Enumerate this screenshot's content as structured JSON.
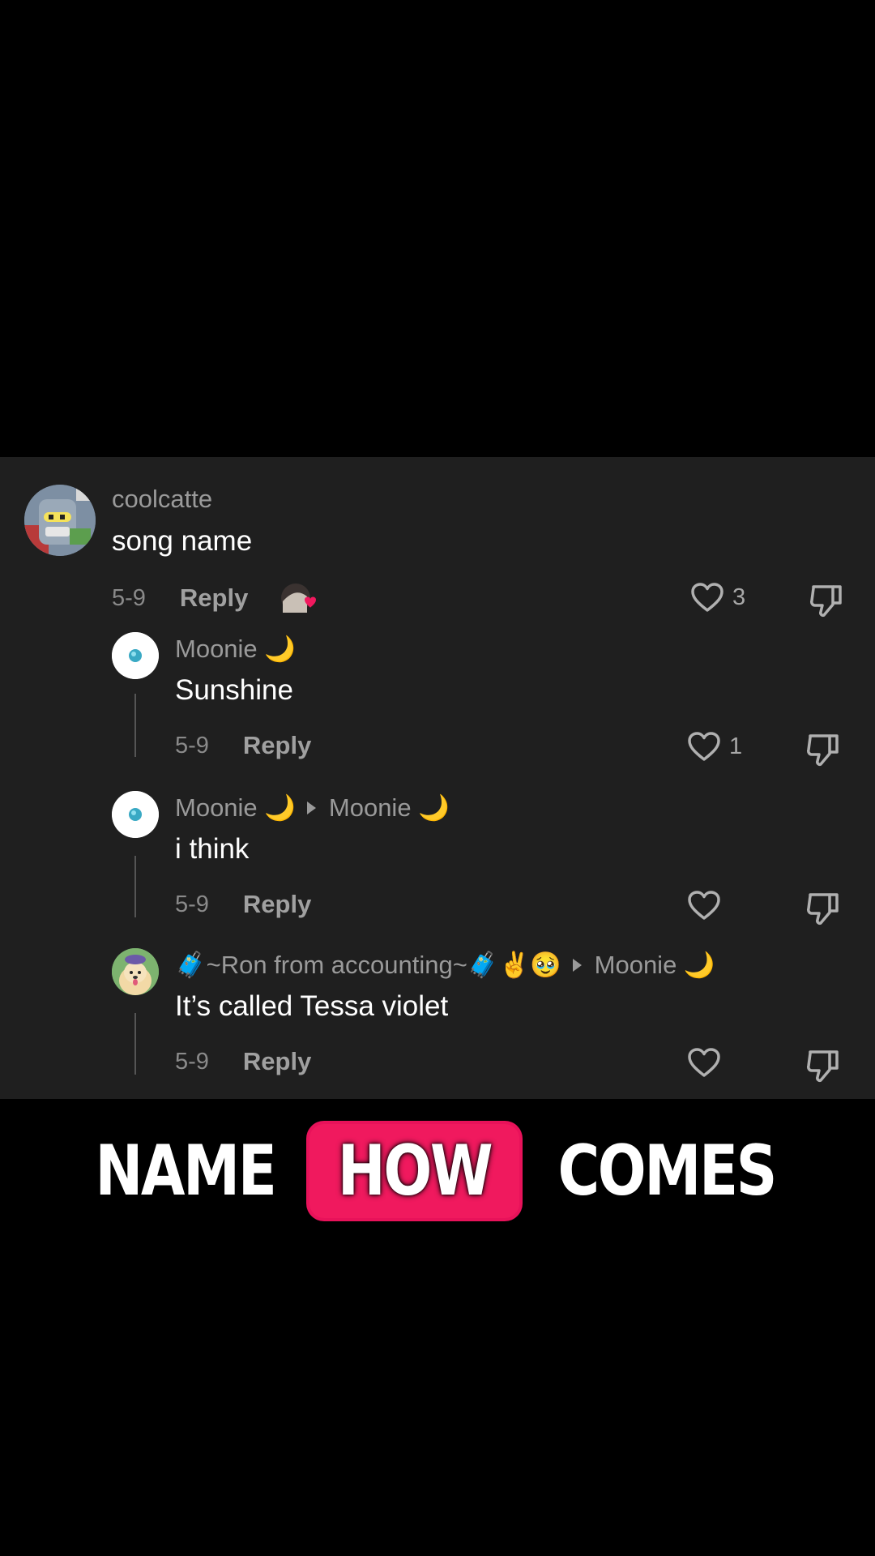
{
  "comments": [
    {
      "username": "coolcatte",
      "text": "song name",
      "date": "5-9",
      "reply_label": "Reply",
      "likes": "3"
    },
    {
      "username": "Moonie 🌙",
      "text": "Sunshine",
      "date": "5-9",
      "reply_label": "Reply",
      "likes": "1"
    },
    {
      "username": "Moonie 🌙",
      "reply_to": "Moonie 🌙",
      "text": "i think",
      "date": "5-9",
      "reply_label": "Reply",
      "likes": ""
    },
    {
      "username": "🧳~Ron from accounting~🧳✌️🥹",
      "reply_to": "Moonie 🌙",
      "text": "It’s called Tessa violet",
      "date": "5-9",
      "reply_label": "Reply",
      "likes": ""
    }
  ],
  "caption": {
    "word1": "NAME",
    "word2": "HOW",
    "word3": "COMES",
    "highlight_color": "#f0195e"
  },
  "icons": [
    "heart-icon",
    "dislike-icon",
    "creator-liked-icon",
    "reply-arrow-icon"
  ]
}
